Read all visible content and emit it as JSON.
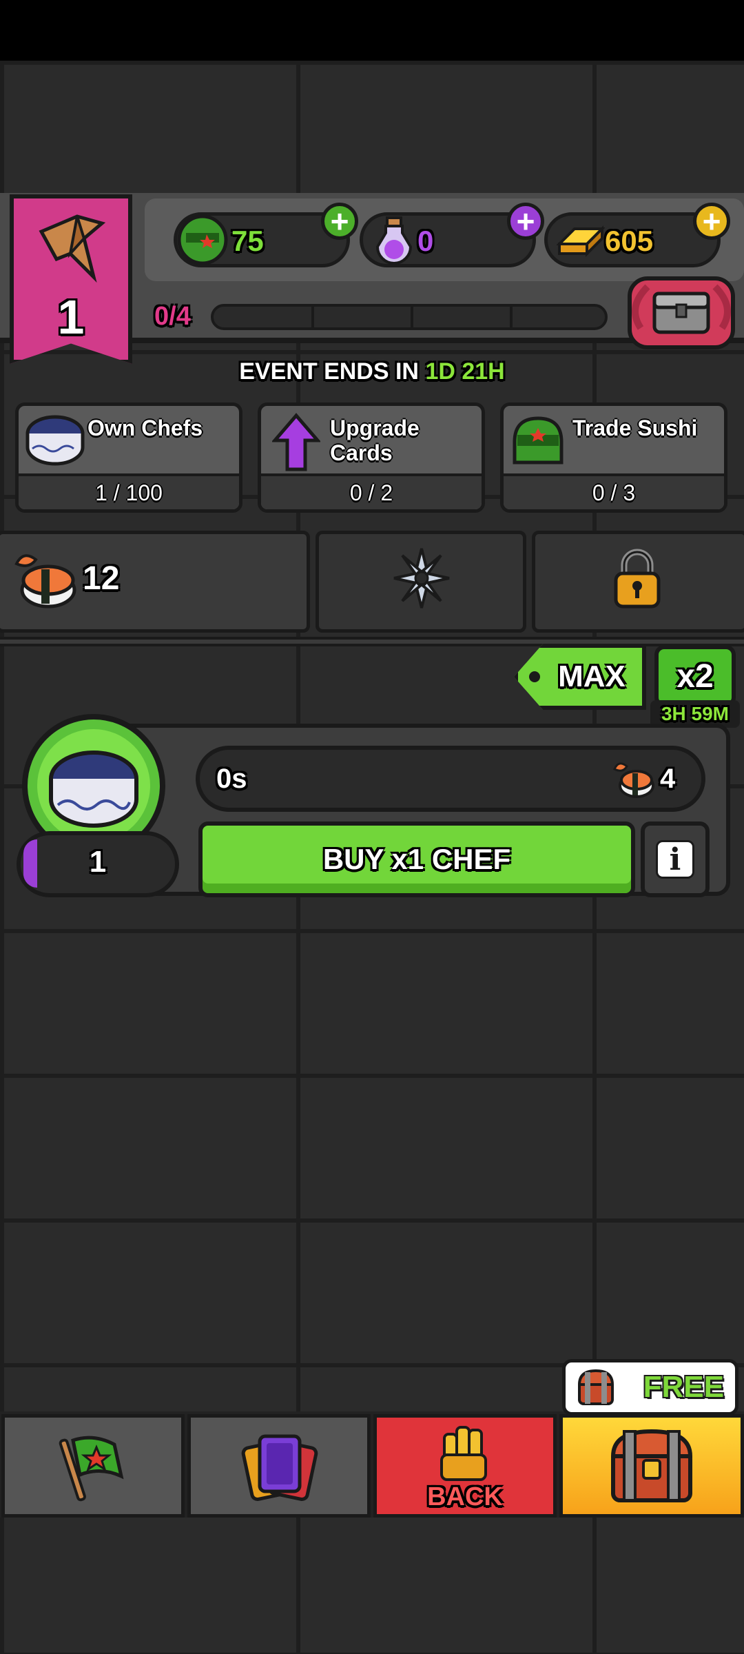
{
  "header": {
    "level": "1",
    "currencies": [
      {
        "icon": "green-mask-icon",
        "value": "75",
        "color": "#7ee03a"
      },
      {
        "icon": "potion-icon",
        "value": "0",
        "color": "#b04de8"
      },
      {
        "icon": "gold-bar-icon",
        "value": "605",
        "color": "#f2c230"
      }
    ],
    "progress_text": "0/4",
    "progress_fraction": 0
  },
  "event": {
    "label": "EVENT ENDS IN",
    "time": "1D 21H"
  },
  "tasks": [
    {
      "icon": "chef-hat-icon",
      "title": "Own Chefs",
      "progress": "1 / 100"
    },
    {
      "icon": "upgrade-arrow-icon",
      "title": "Upgrade Cards",
      "progress": "0 / 2"
    },
    {
      "icon": "green-mask-icon",
      "title": "Trade Sushi",
      "progress": "0 / 3"
    }
  ],
  "resources": {
    "sushi_count": "12"
  },
  "chef": {
    "max_label": "MAX",
    "x2_label": "x2",
    "x2_timer": "3H 59M",
    "timer": "0s",
    "sushi_cost": "4",
    "level": "1",
    "buy_label": "BUY x1 CHEF",
    "info_label": "i"
  },
  "nav": {
    "back_label": "BACK",
    "free_label": "FREE"
  }
}
